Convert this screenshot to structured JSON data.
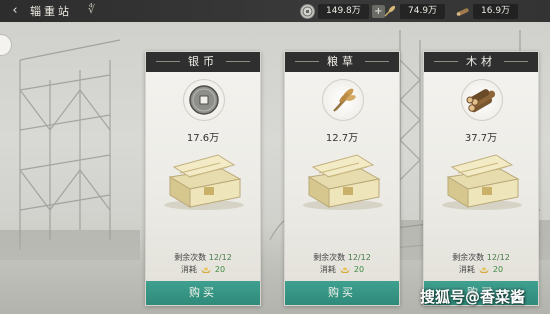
{
  "header": {
    "title": "辎重站",
    "title_deco": "∜",
    "back_icon": "‹"
  },
  "resources": [
    {
      "icon": "coin-icon",
      "value": "149.8万",
      "plus": "+"
    },
    {
      "icon": "grain-icon",
      "value": "74.9万"
    },
    {
      "icon": "wood-icon",
      "value": "16.9万"
    }
  ],
  "cards": [
    {
      "name": "银币",
      "amount": "17.6万",
      "remain_label": "剩余次数",
      "remain_value": "12/12",
      "cost_label": "消耗",
      "cost_value": "20",
      "buy_label": "购买"
    },
    {
      "name": "粮草",
      "amount": "12.7万",
      "remain_label": "剩余次数",
      "remain_value": "12/12",
      "cost_label": "消耗",
      "cost_value": "20",
      "buy_label": "购买"
    },
    {
      "name": "木材",
      "amount": "37.7万",
      "remain_label": "剩余次数",
      "remain_value": "12/12",
      "cost_label": "消耗",
      "cost_value": "20",
      "buy_label": "购买"
    }
  ],
  "watermark": "搜狐号@香菜酱",
  "colors": {
    "buy_button": "#33907f",
    "header": "#2f2f2f",
    "cost_green": "#3f8a3f"
  }
}
